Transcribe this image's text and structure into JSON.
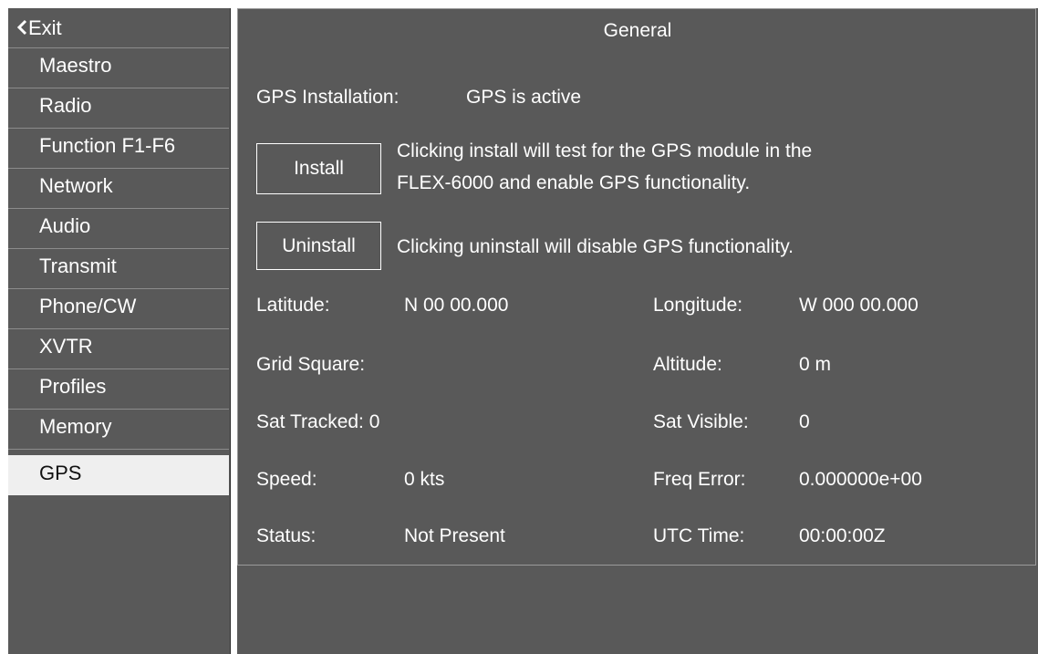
{
  "sidebar": {
    "exit_label": "Exit",
    "items": [
      {
        "label": "Maestro"
      },
      {
        "label": "Radio"
      },
      {
        "label": "Function F1-F6"
      },
      {
        "label": "Network"
      },
      {
        "label": "Audio"
      },
      {
        "label": "Transmit"
      },
      {
        "label": "Phone/CW"
      },
      {
        "label": "XVTR"
      },
      {
        "label": "Profiles"
      },
      {
        "label": "Memory"
      },
      {
        "label": "GPS",
        "selected": true
      }
    ]
  },
  "panel": {
    "title": "General",
    "installation_label": "GPS Installation:",
    "installation_value": "GPS is active",
    "install_button": "Install",
    "install_desc_line1": "Clicking install will test for the GPS module in the",
    "install_desc_line2": "FLEX-6000 and enable GPS functionality.",
    "uninstall_button": "Uninstall",
    "uninstall_desc": "Clicking uninstall will disable GPS functionality.",
    "fields": {
      "latitude_label": "Latitude:",
      "latitude_value": "N 00 00.000",
      "longitude_label": "Longitude:",
      "longitude_value": "W 000 00.000",
      "grid_square_label": "Grid Square:",
      "grid_square_value": "",
      "altitude_label": "Altitude:",
      "altitude_value": "0 m",
      "sat_tracked_label": "Sat Tracked: 0",
      "sat_visible_label": "Sat Visible:",
      "sat_visible_value": "0",
      "speed_label": "Speed:",
      "speed_value": "0 kts",
      "freq_error_label": "Freq Error:",
      "freq_error_value": "0.000000e+00",
      "status_label": "Status:",
      "status_value": "Not Present",
      "utc_time_label": "UTC Time:",
      "utc_time_value": "00:00:00Z"
    }
  },
  "colors": {
    "background": "#595959",
    "text": "#ffffff",
    "selected_background": "#efefef",
    "selected_text": "#111111",
    "divider": "#8c8c8c"
  }
}
